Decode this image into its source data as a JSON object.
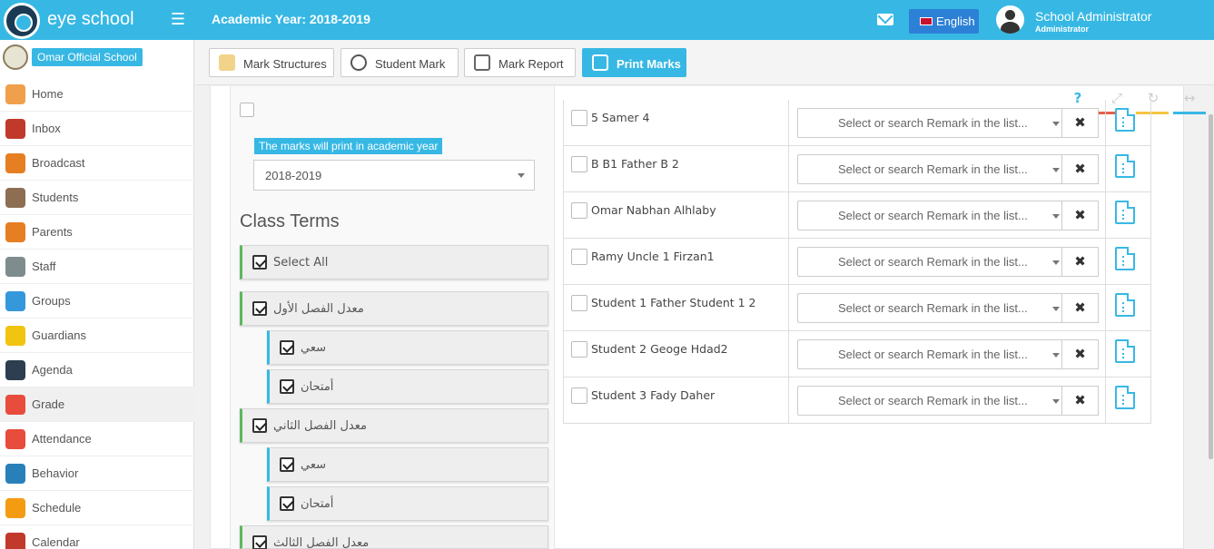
{
  "header": {
    "brand": "eye school",
    "academic_year": "Academic Year: 2018-2019",
    "language": "English",
    "user_name": "School Administrator",
    "user_role": "Administrator"
  },
  "sidebar": {
    "school_name": "Omar Official School",
    "items": [
      {
        "label": "Home",
        "icon": "home-icon",
        "color": "#f0a04b"
      },
      {
        "label": "Inbox",
        "icon": "inbox-icon",
        "color": "#c0392b"
      },
      {
        "label": "Broadcast",
        "icon": "broadcast-icon",
        "color": "#e67e22"
      },
      {
        "label": "Students",
        "icon": "students-icon",
        "color": "#8e6e53"
      },
      {
        "label": "Parents",
        "icon": "parents-icon",
        "color": "#e67e22"
      },
      {
        "label": "Staff",
        "icon": "staff-icon",
        "color": "#7f8c8d"
      },
      {
        "label": "Groups",
        "icon": "groups-icon",
        "color": "#3498db"
      },
      {
        "label": "Guardians",
        "icon": "guardians-icon",
        "color": "#f1c40f"
      },
      {
        "label": "Agenda",
        "icon": "agenda-icon",
        "color": "#2c3e50"
      },
      {
        "label": "Grade",
        "icon": "grade-icon",
        "color": "#e74c3c"
      },
      {
        "label": "Attendance",
        "icon": "attendance-icon",
        "color": "#e74c3c"
      },
      {
        "label": "Behavior",
        "icon": "behavior-icon",
        "color": "#2980b9"
      },
      {
        "label": "Schedule",
        "icon": "schedule-icon",
        "color": "#f39c12"
      },
      {
        "label": "Calendar",
        "icon": "calendar-icon",
        "color": "#c0392b"
      }
    ]
  },
  "toolbar": {
    "mark_structures": "Mark Structures",
    "student_mark": "Student Mark",
    "mark_report": "Mark Report",
    "print_marks": "Print Marks"
  },
  "filters": {
    "academic_year_label": "The marks will print in academic year",
    "academic_year_value": "2018-2019",
    "class_terms_title": "Class Terms",
    "terms": [
      {
        "label": "Select All",
        "level": 1,
        "checked": true
      },
      {
        "label": "معدل الفصل الأول",
        "level": 1,
        "checked": true
      },
      {
        "label": "سعي",
        "level": 2,
        "checked": true
      },
      {
        "label": "أمتحان",
        "level": 2,
        "checked": true
      },
      {
        "label": "معدل الفصل الثاني",
        "level": 1,
        "checked": true
      },
      {
        "label": "سعي",
        "level": 2,
        "checked": true
      },
      {
        "label": "أمتحان",
        "level": 2,
        "checked": true
      },
      {
        "label": "معدل الفصل الثالث",
        "level": 1,
        "checked": true
      }
    ]
  },
  "students": {
    "remark_placeholder": "Select or search Remark in the list...",
    "clear_label": "✖",
    "rows": [
      {
        "name": "5 Samer 4"
      },
      {
        "name": "B B1 Father B 2"
      },
      {
        "name": "Omar Nabhan Alhlaby"
      },
      {
        "name": "Ramy Uncle 1 Firzan1"
      },
      {
        "name": "Student 1 Father Student 1 2"
      },
      {
        "name": "Student 2 Geoge Hdad2"
      },
      {
        "name": "Student 3 Fady Daher"
      }
    ]
  },
  "colors": {
    "accent": "#37b8e4",
    "language_button": "#2c80d6",
    "panel_bar_red": "#e8604c",
    "panel_bar_yellow": "#f4c542"
  }
}
